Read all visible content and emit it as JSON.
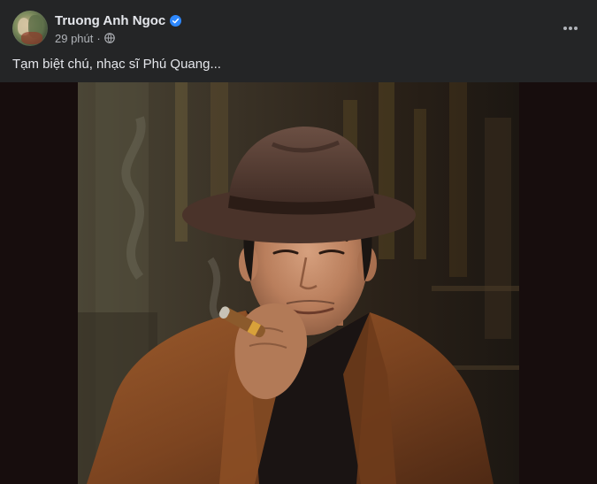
{
  "post": {
    "author": {
      "name": "Truong Anh Ngoc",
      "verified_icon": "verified-badge-icon"
    },
    "meta": {
      "time": "29 phút",
      "separator": "·",
      "audience_icon": "globe-icon"
    },
    "more_icon": "more-options-icon",
    "caption": "Tạm biệt chú, nhạc sĩ Phú Quang...",
    "photo_icon": "portrait-photo"
  },
  "colors": {
    "background": "#242526",
    "text_primary": "#e4e6eb",
    "text_secondary": "#b0b3b8",
    "verified_blue": "#2d88ff"
  }
}
